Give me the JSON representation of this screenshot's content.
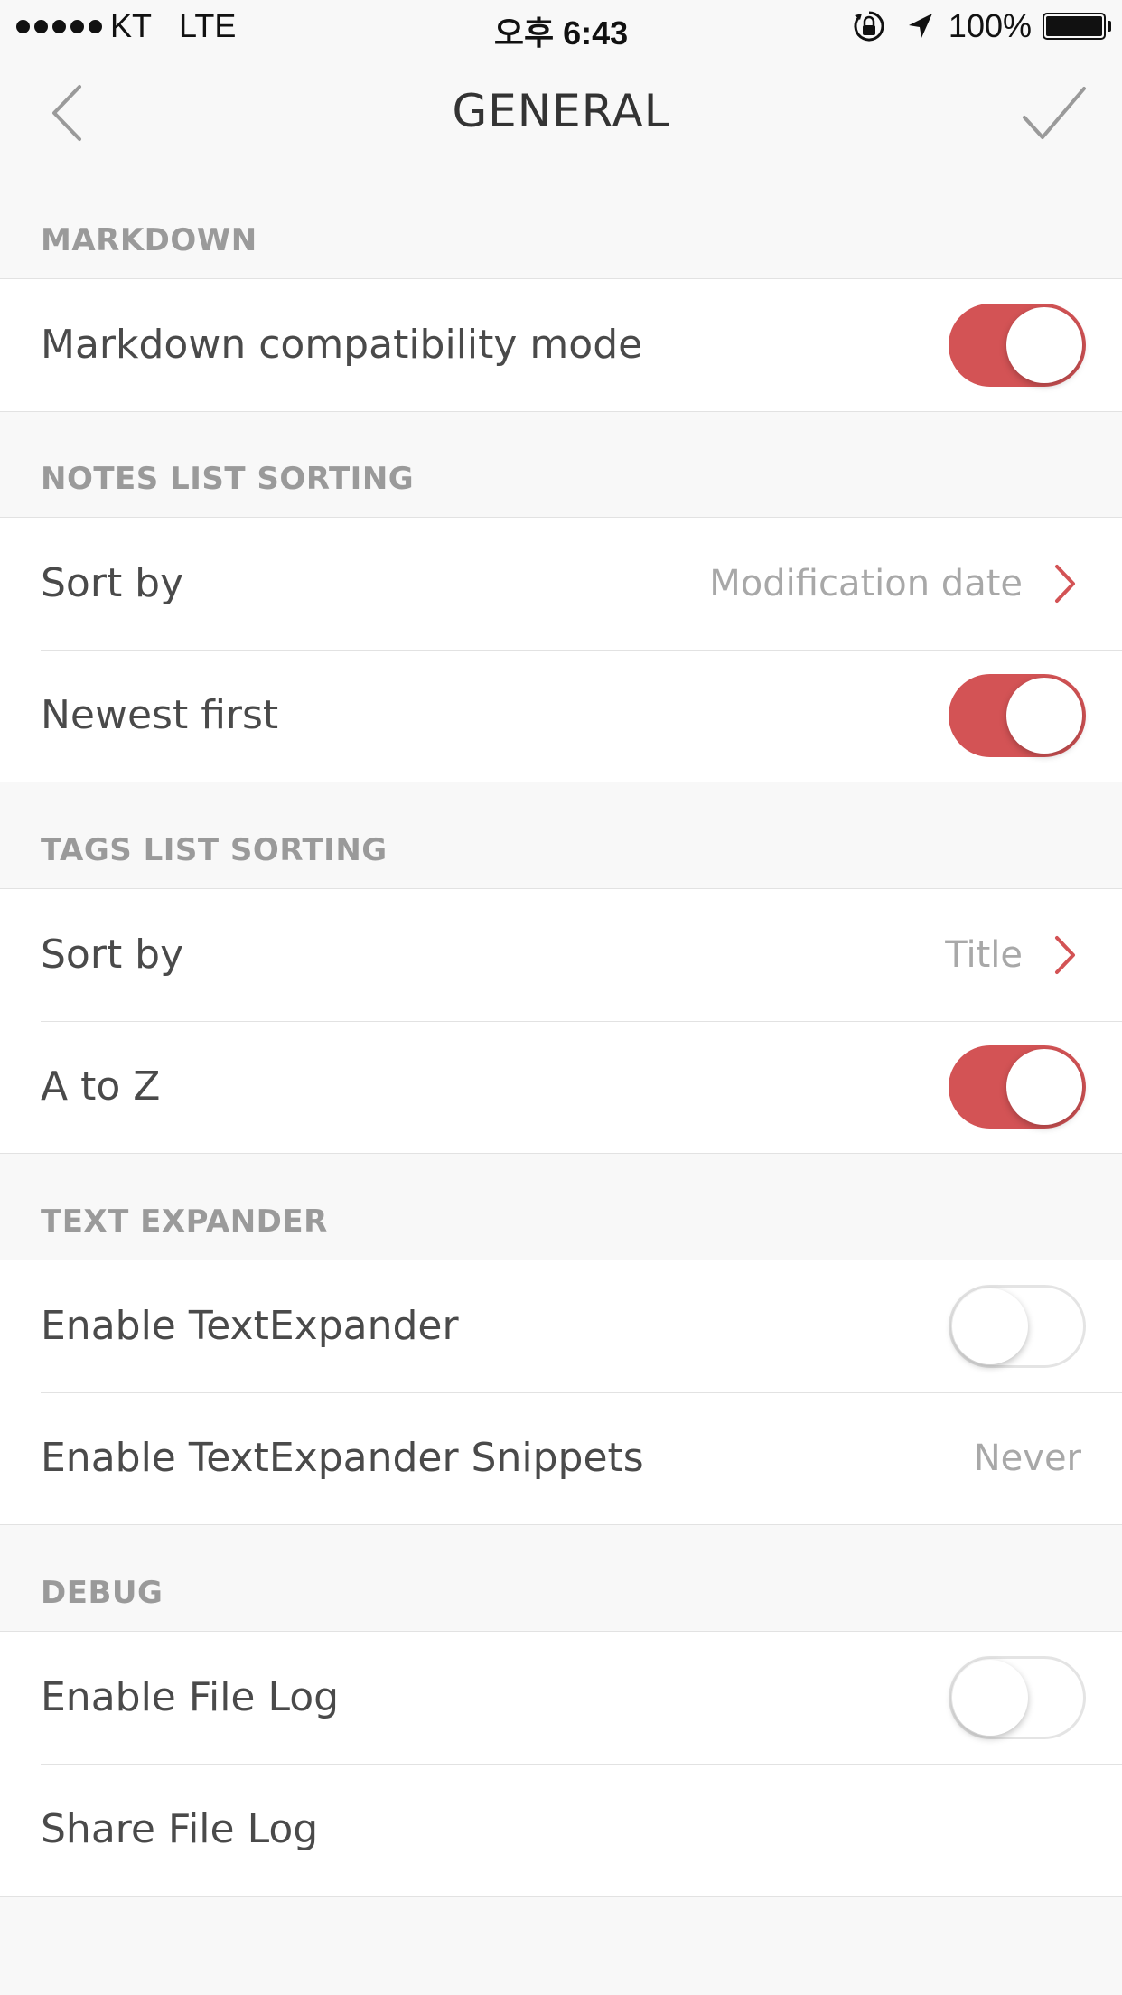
{
  "status_bar": {
    "carrier": "KT",
    "network": "LTE",
    "time": "오후 6:43",
    "battery": "100%"
  },
  "nav": {
    "title": "GENERAL",
    "back_icon": "chevron-left-icon",
    "done_icon": "checkmark-icon"
  },
  "accent_color": "#d35355",
  "sections": {
    "markdown": {
      "header": "MARKDOWN",
      "rows": [
        {
          "label": "Markdown compatibility mode",
          "toggle": true
        }
      ]
    },
    "notes": {
      "header": "NOTES LIST SORTING",
      "rows": [
        {
          "label": "Sort by",
          "value": "Modification date"
        },
        {
          "label": "Newest first",
          "toggle": true
        }
      ]
    },
    "tags": {
      "header": "TAGS LIST SORTING",
      "rows": [
        {
          "label": "Sort by",
          "value": "Title"
        },
        {
          "label": "A to Z",
          "toggle": true
        }
      ]
    },
    "textexpander": {
      "header": "TEXT EXPANDER",
      "rows": [
        {
          "label": "Enable TextExpander",
          "toggle": false
        },
        {
          "label": "Enable TextExpander Snippets",
          "value": "Never"
        }
      ]
    },
    "debug": {
      "header": "DEBUG",
      "rows": [
        {
          "label": "Enable File Log",
          "toggle": false
        },
        {
          "label": "Share File Log"
        }
      ]
    }
  }
}
